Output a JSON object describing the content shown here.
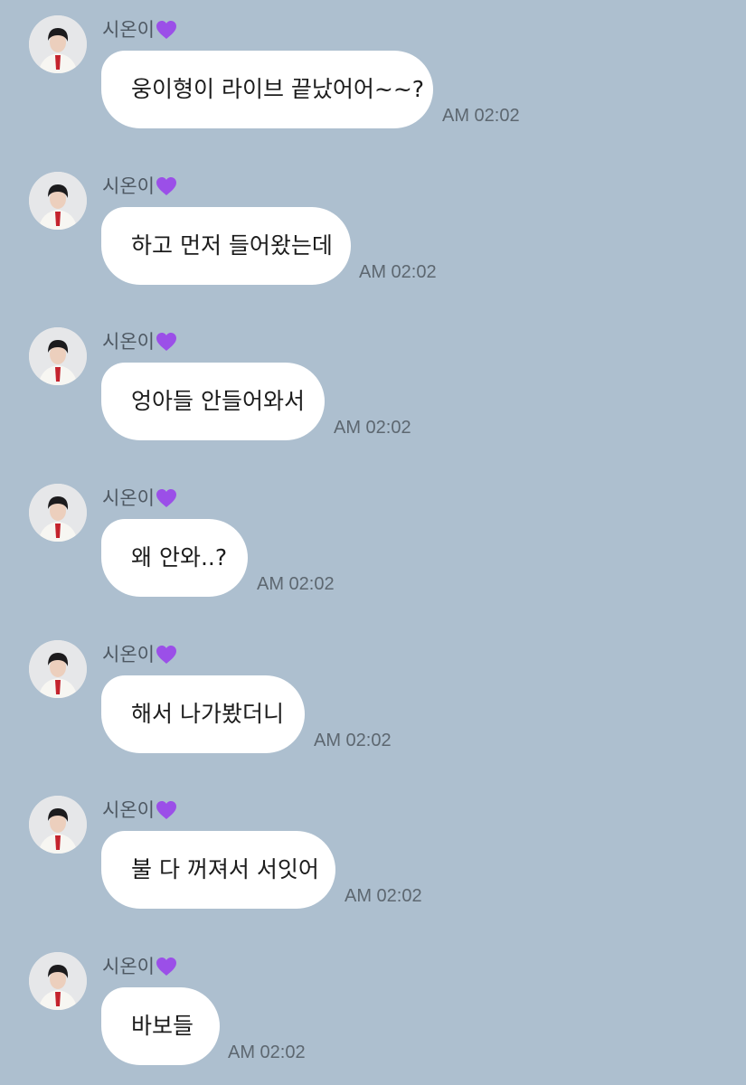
{
  "messages": [
    {
      "sender": "시온이",
      "text": "웅이형이 라이브 끝났어어~~?",
      "time": "AM 02:02"
    },
    {
      "sender": "시온이",
      "text": "하고 먼저 들어왔는데",
      "time": "AM 02:02"
    },
    {
      "sender": "시온이",
      "text": "엉아들 안들어와서",
      "time": "AM 02:02"
    },
    {
      "sender": "시온이",
      "text": "왜 안와..?",
      "time": "AM 02:02"
    },
    {
      "sender": "시온이",
      "text": "해서 나가봤더니",
      "time": "AM 02:02"
    },
    {
      "sender": "시온이",
      "text": "불 다 꺼져서 서잇어",
      "time": "AM 02:02"
    },
    {
      "sender": "시온이",
      "text": "바보들",
      "time": "AM 02:02"
    }
  ],
  "icons": {
    "sender_badge": "purple-heart-icon",
    "avatar": "profile-avatar"
  },
  "colors": {
    "background": "#adbfcf",
    "bubble": "#ffffff",
    "heart": "#9b4fe8"
  }
}
